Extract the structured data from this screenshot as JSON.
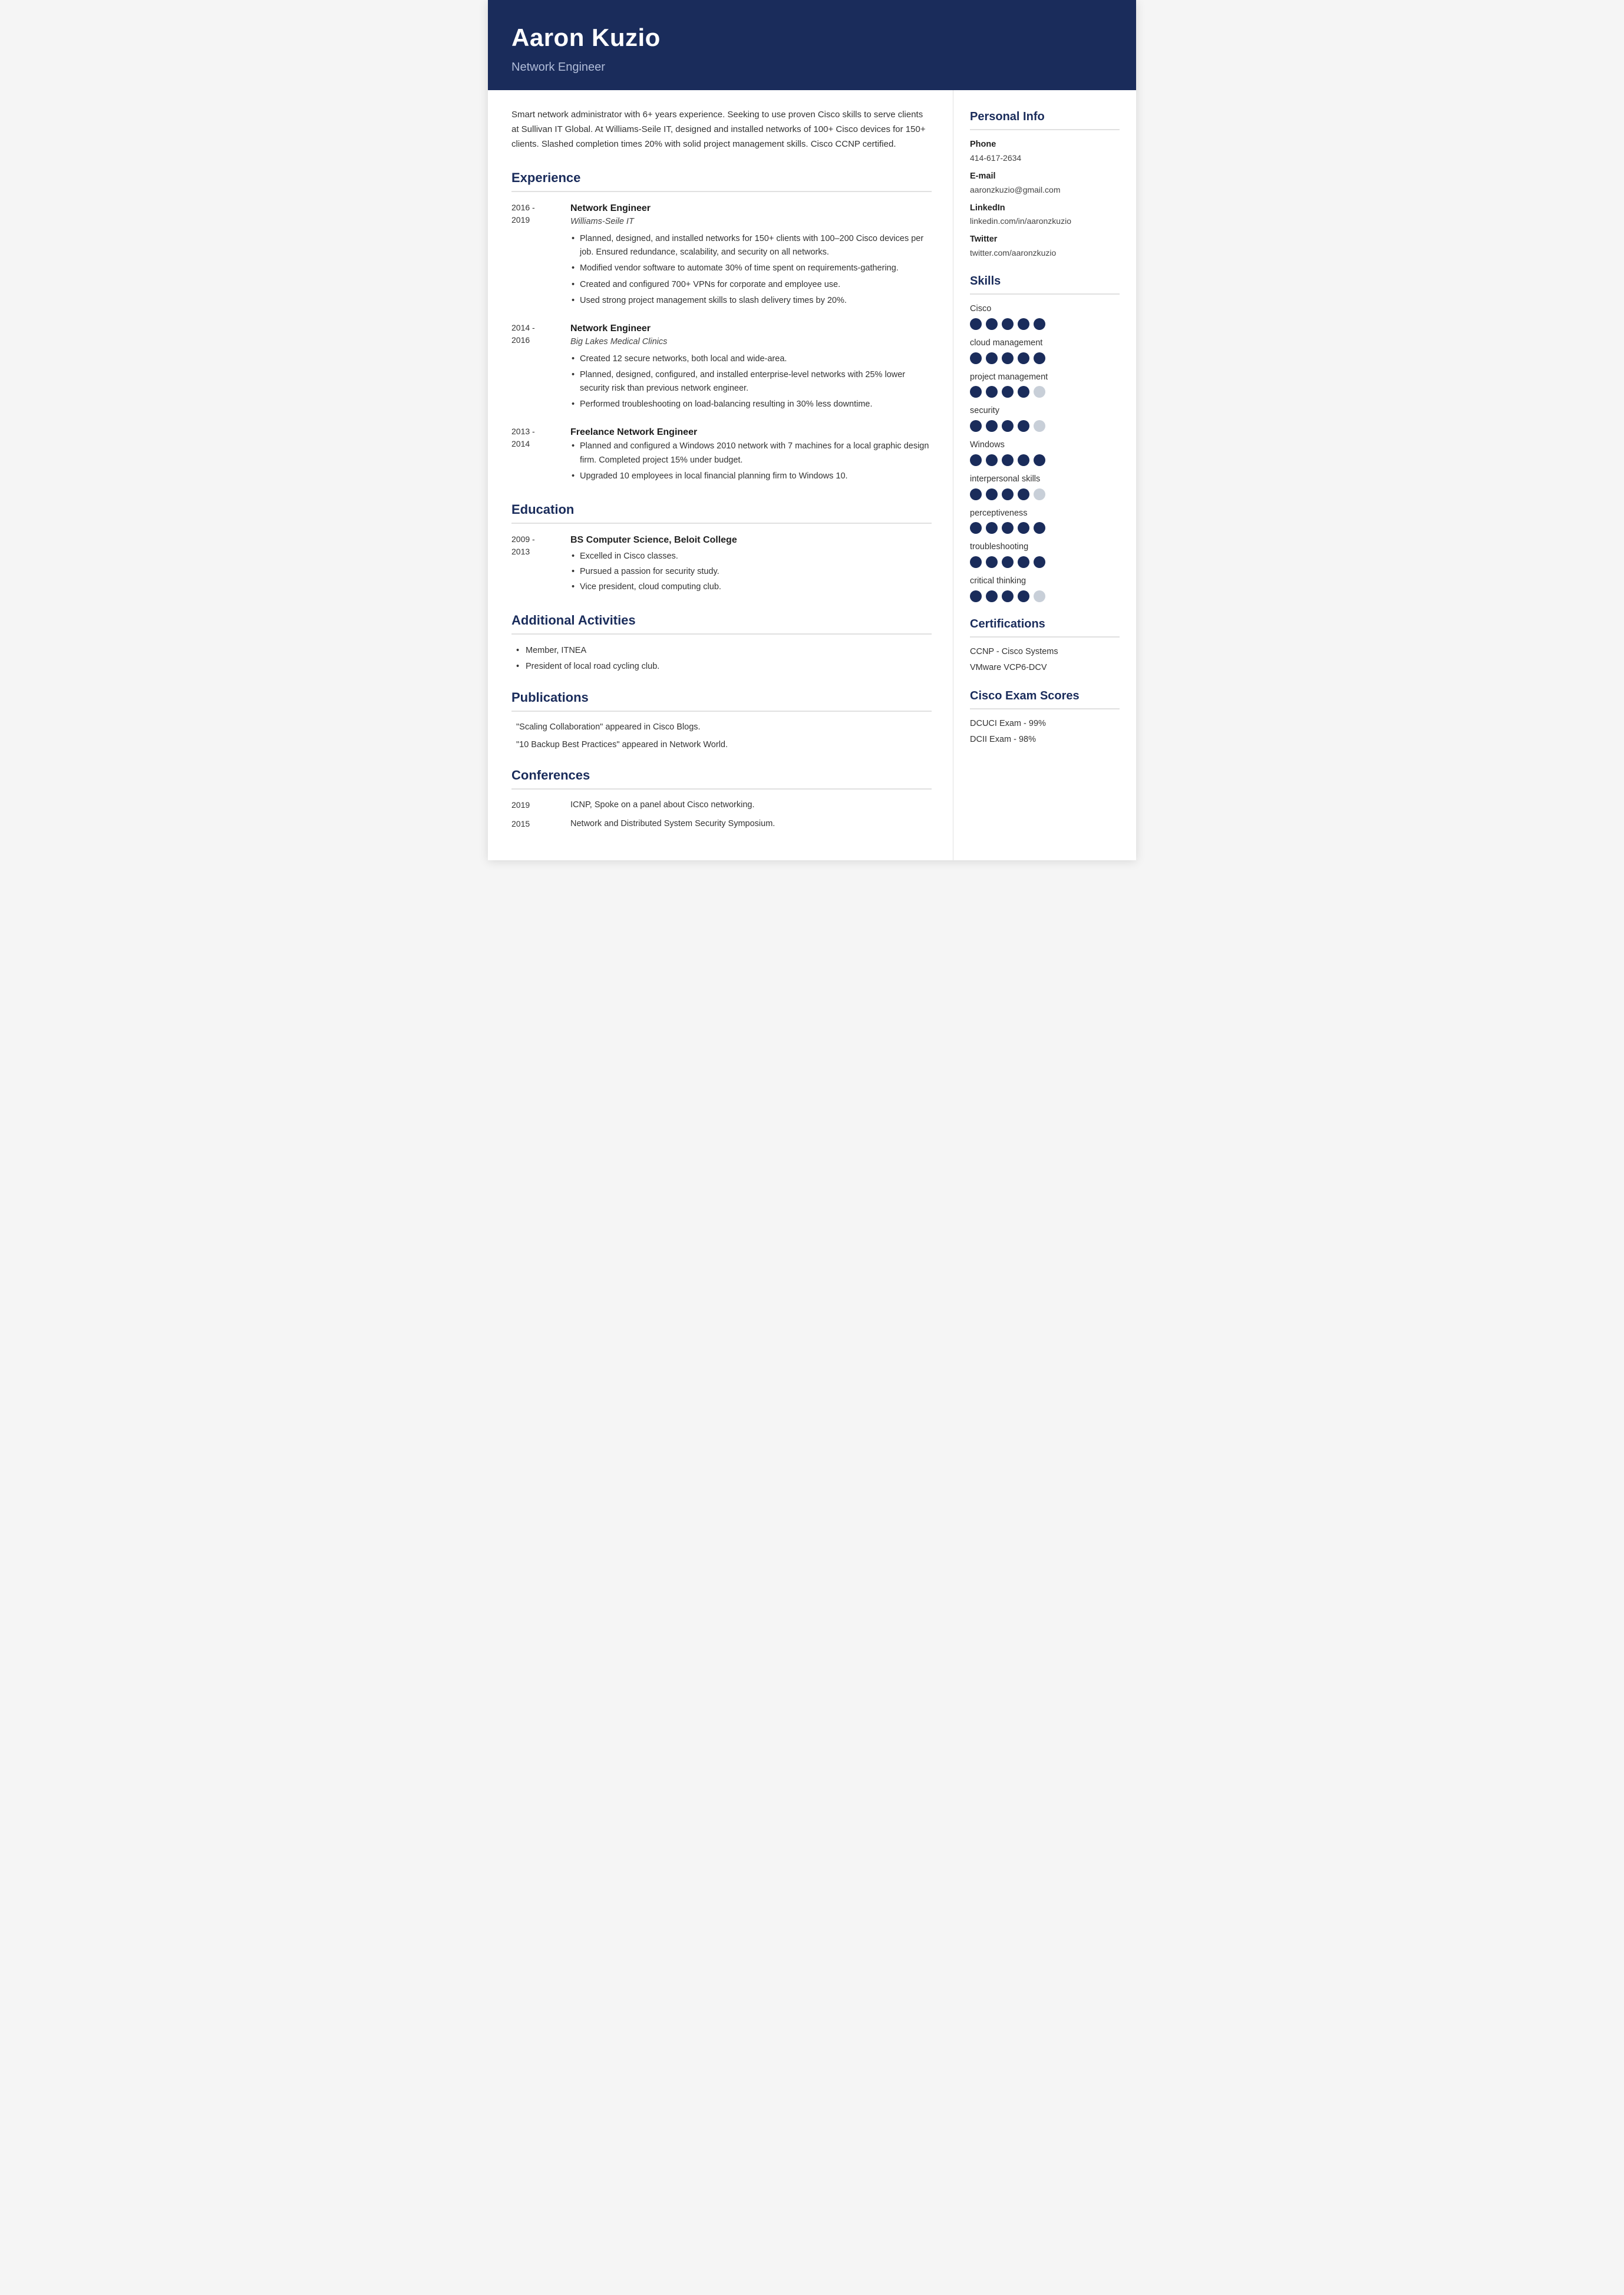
{
  "header": {
    "name": "Aaron Kuzio",
    "title": "Network Engineer"
  },
  "summary": "Smart network administrator with 6+ years experience. Seeking to use proven Cisco skills to serve clients at Sullivan IT Global. At Williams-Seile IT, designed and installed networks of 100+ Cisco devices for 150+ clients. Slashed completion times 20% with solid project management skills. Cisco CCNP certified.",
  "sections": {
    "experience_label": "Experience",
    "education_label": "Education",
    "additional_label": "Additional Activities",
    "publications_label": "Publications",
    "conferences_label": "Conferences"
  },
  "experience": [
    {
      "date_start": "2016 -",
      "date_end": "2019",
      "title": "Network Engineer",
      "company": "Williams-Seile IT",
      "bullets": [
        "Planned, designed, and installed networks for 150+ clients with 100–200 Cisco devices per job. Ensured redundance, scalability, and security on all networks.",
        "Modified vendor software to automate 30% of time spent on requirements-gathering.",
        "Created and configured 700+ VPNs for corporate and employee use.",
        "Used strong project management skills to slash delivery times by 20%."
      ]
    },
    {
      "date_start": "2014 -",
      "date_end": "2016",
      "title": "Network Engineer",
      "company": "Big Lakes Medical Clinics",
      "bullets": [
        "Created 12 secure networks, both local and wide-area.",
        "Planned, designed, configured, and installed enterprise-level networks with 25% lower security risk than previous network engineer.",
        "Performed troubleshooting on load-balancing resulting in 30% less downtime."
      ]
    },
    {
      "date_start": "2013 -",
      "date_end": "2014",
      "title": "Freelance Network Engineer",
      "company": "",
      "bullets": [
        "Planned and configured a Windows 2010 network with 7 machines for a local graphic design firm. Completed project 15% under budget.",
        "Upgraded 10 employees in local financial planning firm to Windows 10."
      ]
    }
  ],
  "education": [
    {
      "date_start": "2009 -",
      "date_end": "2013",
      "degree": "BS Computer Science, Beloit College",
      "bullets": [
        "Excelled in Cisco classes.",
        "Pursued a passion for security study.",
        "Vice president, cloud computing club."
      ]
    }
  ],
  "additional": [
    "Member, ITNEA",
    "President of local road cycling club."
  ],
  "publications": [
    "\"Scaling Collaboration\" appeared in Cisco Blogs.",
    "\"10 Backup Best Practices\" appeared in Network World."
  ],
  "conferences": [
    {
      "year": "2019",
      "description": "ICNP, Spoke on a panel about Cisco networking."
    },
    {
      "year": "2015",
      "description": "Network and Distributed System Security Symposium."
    }
  ],
  "personal_info": {
    "label": "Personal Info",
    "phone_label": "Phone",
    "phone": "414-617-2634",
    "email_label": "E-mail",
    "email": "aaronzkuzio@gmail.com",
    "linkedin_label": "LinkedIn",
    "linkedin": "linkedin.com/in/aaronzkuzio",
    "twitter_label": "Twitter",
    "twitter": "twitter.com/aaronzkuzio"
  },
  "skills": {
    "label": "Skills",
    "items": [
      {
        "name": "Cisco",
        "filled": 5,
        "total": 5
      },
      {
        "name": "cloud management",
        "filled": 5,
        "total": 5
      },
      {
        "name": "project management",
        "filled": 4,
        "total": 5
      },
      {
        "name": "security",
        "filled": 4,
        "total": 5
      },
      {
        "name": "Windows",
        "filled": 5,
        "total": 5
      },
      {
        "name": "interpersonal skills",
        "filled": 4,
        "total": 5
      },
      {
        "name": "perceptiveness",
        "filled": 5,
        "total": 5
      },
      {
        "name": "troubleshooting",
        "filled": 5,
        "total": 5
      },
      {
        "name": "critical thinking",
        "filled": 4,
        "total": 5
      }
    ]
  },
  "certifications": {
    "label": "Certifications",
    "items": [
      "CCNP - Cisco Systems",
      "VMware VCP6-DCV"
    ]
  },
  "cisco_exam_scores": {
    "label": "Cisco Exam Scores",
    "items": [
      "DCUCI Exam - 99%",
      "DCII Exam - 98%"
    ]
  }
}
